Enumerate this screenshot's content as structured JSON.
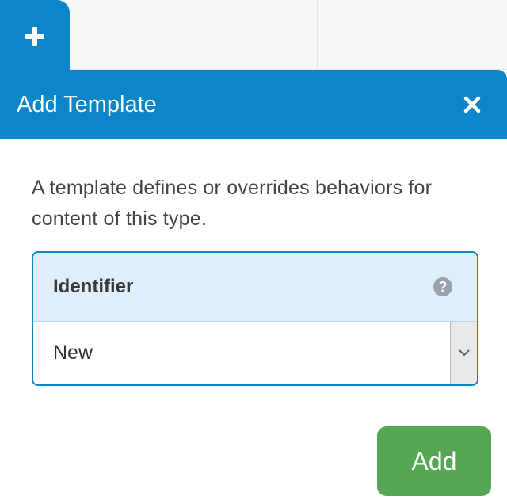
{
  "tab": {
    "add_icon": "plus-icon"
  },
  "dialog": {
    "title": "Add Template",
    "close_icon": "close-icon",
    "description": "A template defines or overrides behaviors for content of this type.",
    "field": {
      "label": "Identifier",
      "help_icon": "question-circle-icon",
      "help_glyph": "?",
      "selected_value": "New",
      "dropdown_icon": "chevron-down-icon"
    },
    "submit_label": "Add"
  },
  "colors": {
    "primary": "#0b87c9",
    "field_header_bg": "#deeefb",
    "submit": "#55a754",
    "text": "#444444"
  }
}
